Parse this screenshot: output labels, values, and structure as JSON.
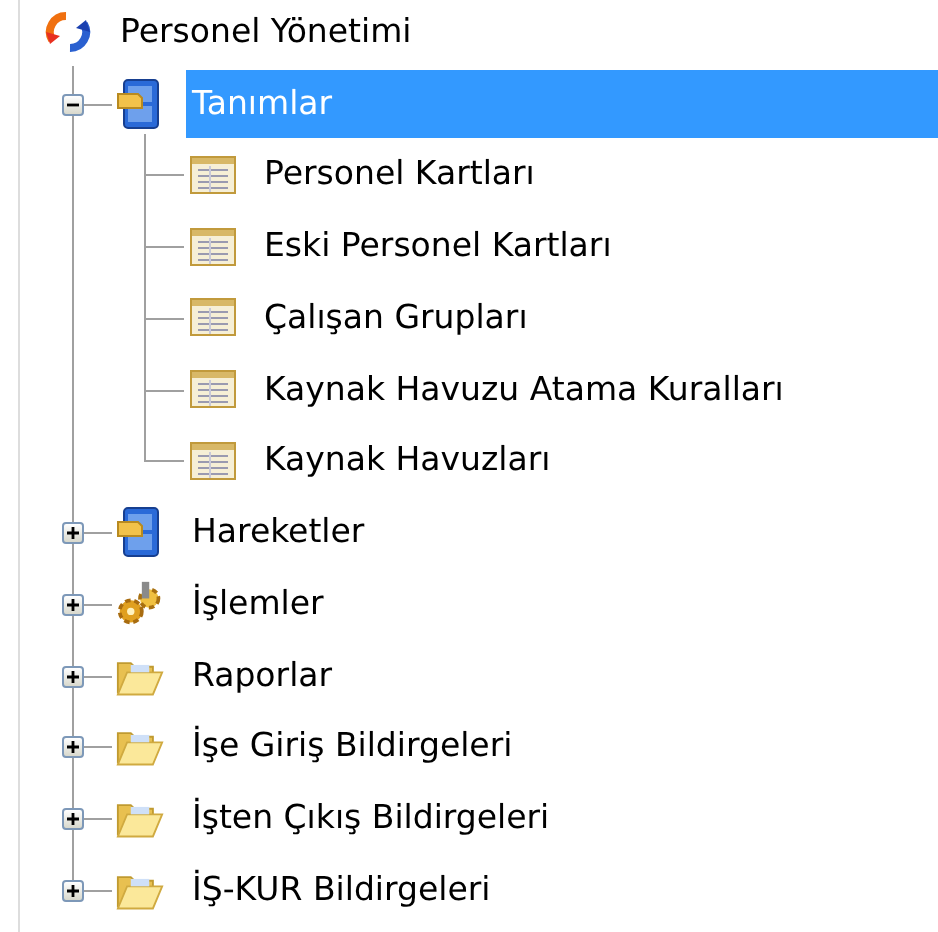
{
  "tree": {
    "label": "Personel Yönetimi",
    "kind": "logo",
    "selected": false,
    "children": [
      {
        "label": "Tanımlar",
        "kind": "cabinet",
        "selected": true,
        "expanded": true,
        "children": [
          {
            "label": "Personel Kartları",
            "kind": "form",
            "selected": false
          },
          {
            "label": "Eski Personel Kartları",
            "kind": "form",
            "selected": false
          },
          {
            "label": "Çalışan Grupları",
            "kind": "form",
            "selected": false
          },
          {
            "label": "Kaynak Havuzu Atama Kuralları",
            "kind": "form",
            "selected": false
          },
          {
            "label": "Kaynak Havuzları",
            "kind": "form",
            "selected": false
          }
        ]
      },
      {
        "label": "Hareketler",
        "kind": "cabinet",
        "selected": false,
        "expanded": false
      },
      {
        "label": "İşlemler",
        "kind": "gears",
        "selected": false,
        "expanded": false
      },
      {
        "label": "Raporlar",
        "kind": "folder",
        "selected": false,
        "expanded": false
      },
      {
        "label": "İşe Giriş Bildirgeleri",
        "kind": "folder",
        "selected": false,
        "expanded": false
      },
      {
        "label": "İşten Çıkış Bildirgeleri",
        "kind": "folder",
        "selected": false,
        "expanded": false
      },
      {
        "label": "İŞ-KUR Bildirgeleri",
        "kind": "folder",
        "selected": false,
        "expanded": false
      }
    ]
  }
}
